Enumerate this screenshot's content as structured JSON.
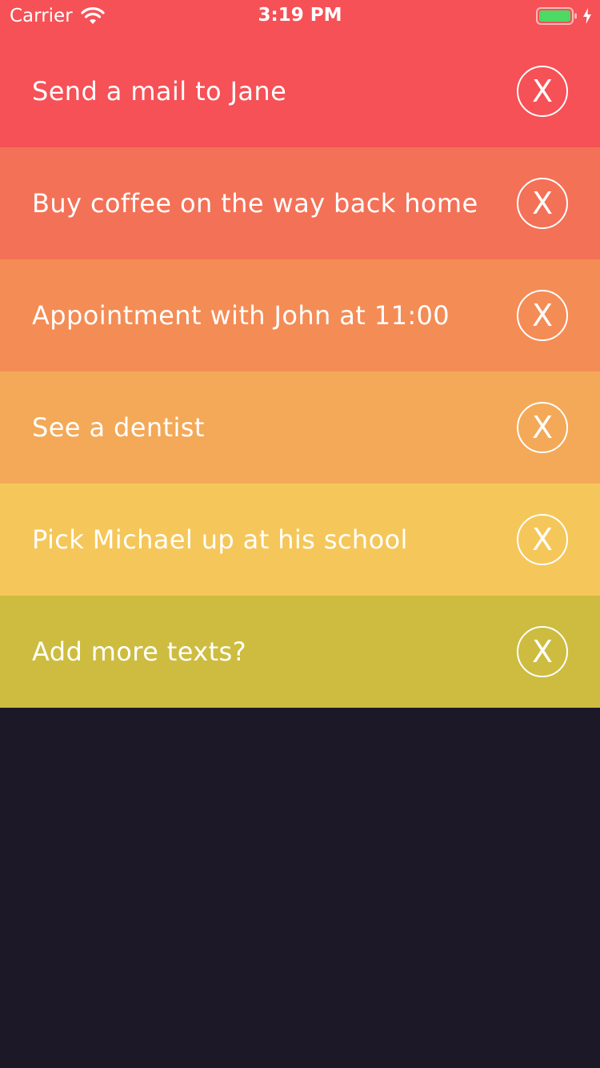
{
  "status_bar": {
    "carrier": "Carrier",
    "time": "3:19 PM",
    "wifi_icon": "wifi-icon",
    "battery_icon": "battery-icon",
    "battery_level": 1.0,
    "charging_icon": "charging-bolt-icon"
  },
  "tasks": [
    {
      "text": "Send a mail to Jane",
      "color": "#f55156",
      "delete_label": "X"
    },
    {
      "text": "Buy coffee on the way back home",
      "color": "#f37157",
      "delete_label": "X"
    },
    {
      "text": "Appointment with John at 11:00",
      "color": "#f48c56",
      "delete_label": "X"
    },
    {
      "text": "See a dentist",
      "color": "#f3a958",
      "delete_label": "X"
    },
    {
      "text": "Pick Michael up at his school",
      "color": "#f5c75a",
      "delete_label": "X"
    },
    {
      "text": "Add more texts?",
      "color": "#cdbc40",
      "delete_label": "X"
    }
  ],
  "colors": {
    "background": "#1c1828",
    "text": "#ffffff",
    "battery_fill": "#4cd964"
  }
}
